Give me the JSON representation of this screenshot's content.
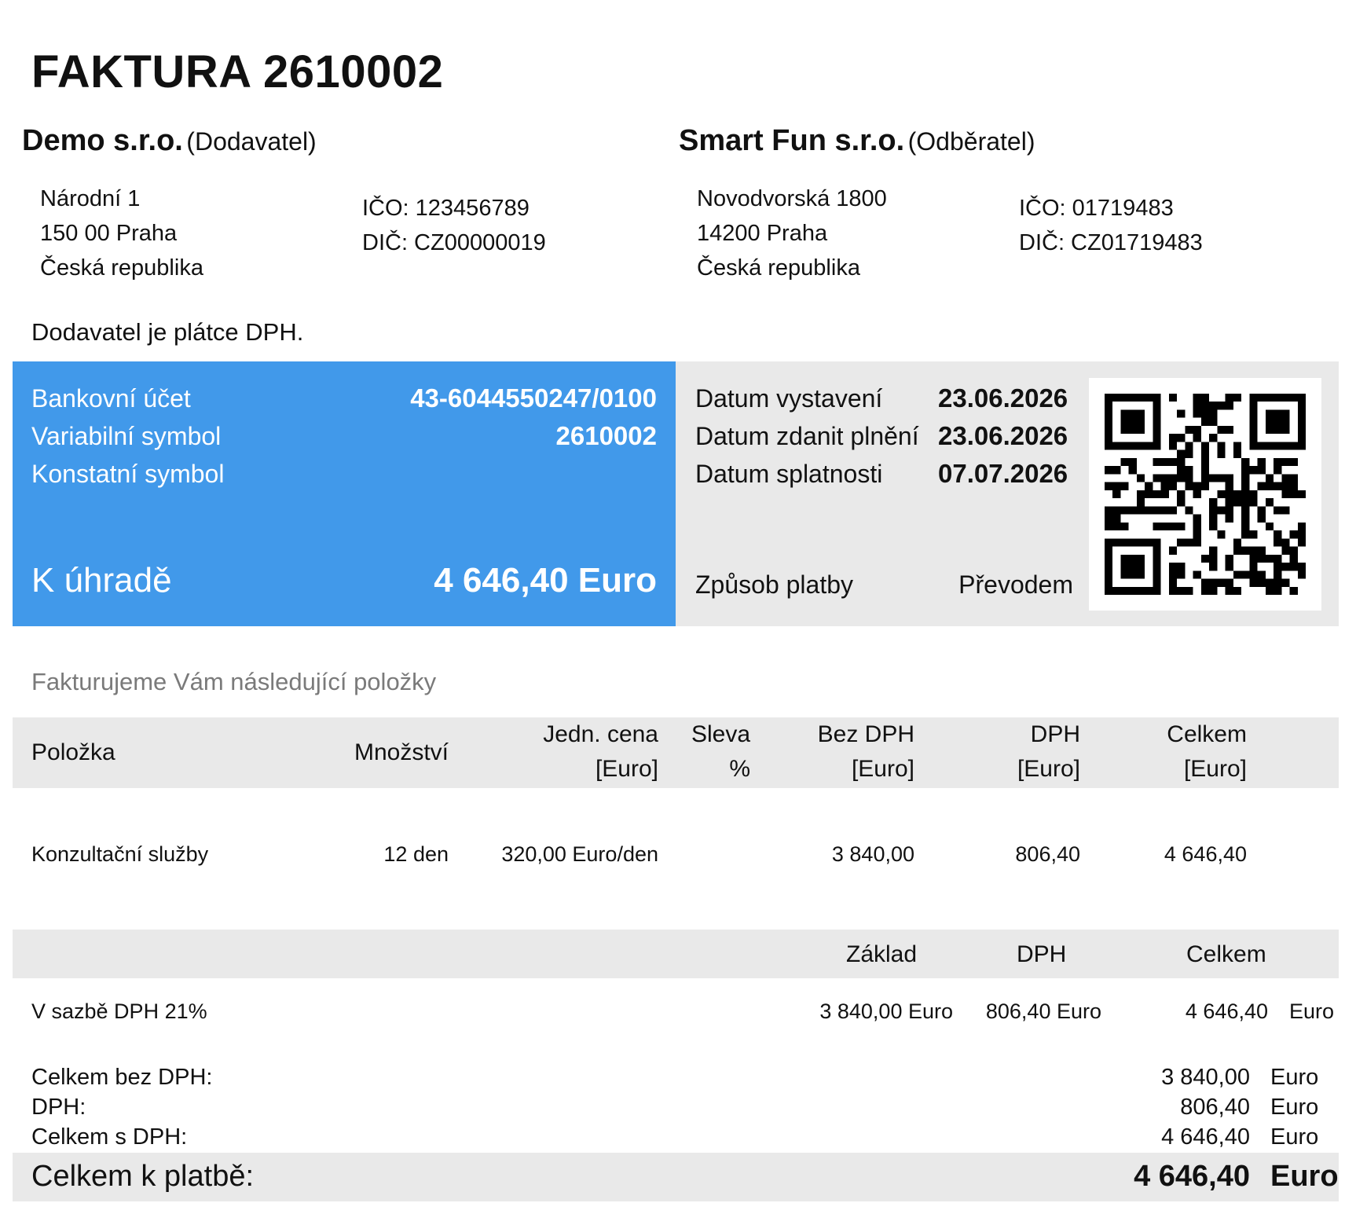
{
  "invoice": {
    "title": "FAKTURA 2610002"
  },
  "supplier": {
    "name": "Demo s.r.o.",
    "role": "(Dodavatel)",
    "street": "Národní 1",
    "city": "150 00 Praha",
    "country": "Česká republika",
    "ico": "IČO: 123456789",
    "dic": "DIČ: CZ00000019"
  },
  "customer": {
    "name": "Smart Fun s.r.o.",
    "role": "(Odběratel)",
    "street": "Novodvorská 1800",
    "city": "14200 Praha",
    "country": "Česká republika",
    "ico": "IČO: 01719483",
    "dic": "DIČ: CZ01719483"
  },
  "vat_note": "Dodavatel je plátce DPH.",
  "payment": {
    "bank_label": "Bankovní účet",
    "bank_value": "43-6044550247/0100",
    "vs_label": "Variabilní symbol",
    "vs_value": "2610002",
    "ks_label": "Konstatní symbol",
    "due_label": "K úhradě",
    "due_value": "4 646,40 Euro"
  },
  "dates": {
    "issued_label": "Datum vystavení",
    "issued_value": "23.06.2026",
    "taxable_label": "Datum zdanit plnění",
    "taxable_value": "23.06.2026",
    "due_label": "Datum splatnosti",
    "due_value": "07.07.2026",
    "method_label": "Způsob platby",
    "method_value": "Převodem"
  },
  "items_intro": "Fakturujeme Vám následující položky",
  "items_header": {
    "item": "Položka",
    "qty": "Množství",
    "unit_price_1": "Jedn. cena",
    "unit_price_2": "[Euro]",
    "discount_1": "Sleva",
    "discount_2": "%",
    "net_1": "Bez DPH",
    "net_2": "[Euro]",
    "vat_1": "DPH",
    "vat_2": "[Euro]",
    "total_1": "Celkem",
    "total_2": "[Euro]"
  },
  "items": [
    {
      "name": "Konzultační služby",
      "qty": "12 den",
      "unit_price": "320,00 Euro/den",
      "net": "3 840,00",
      "vat": "806,40",
      "total": "4 646,40"
    }
  ],
  "vat_summary": {
    "header": {
      "base": "Základ",
      "vat": "DPH",
      "total": "Celkem"
    },
    "rows": [
      {
        "label": "V sazbě DPH 21%",
        "base": "3 840,00 Euro",
        "vat": "806,40 Euro",
        "total": "4 646,40",
        "currency": "Euro"
      }
    ]
  },
  "totals": [
    {
      "label": "Celkem bez DPH:",
      "value": "3 840,00",
      "currency": "Euro"
    },
    {
      "label": "DPH:",
      "value": "806,40",
      "currency": "Euro"
    },
    {
      "label": "Celkem s DPH:",
      "value": "4 646,40",
      "currency": "Euro"
    }
  ],
  "grand_total": {
    "label": "Celkem k platbě:",
    "value": "4 646,40",
    "currency": "Euro"
  },
  "qr": {
    "name": "payment-qr-code"
  }
}
